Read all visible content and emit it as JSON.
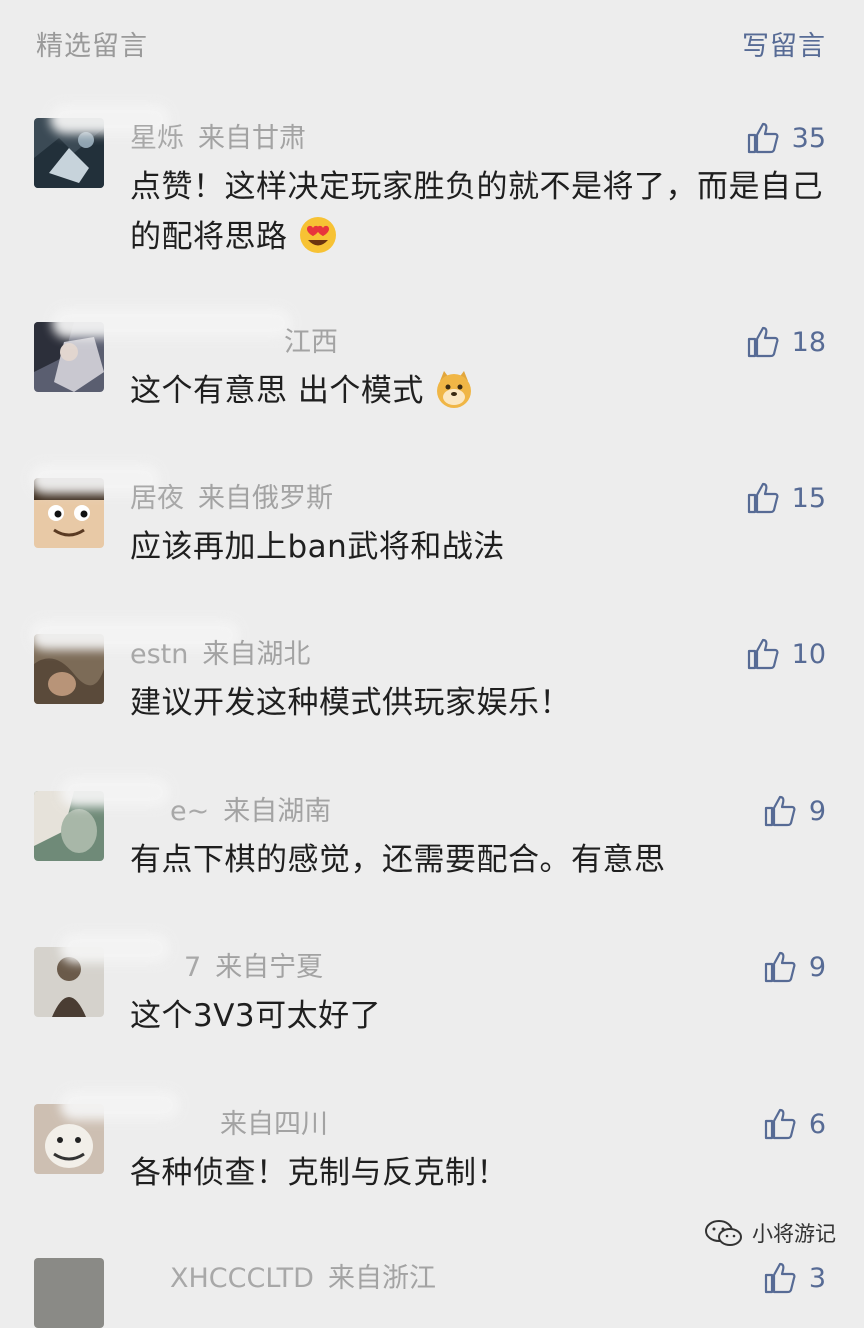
{
  "header": {
    "title": "精选留言",
    "write_link": "写留言"
  },
  "comments": [
    {
      "nickname": "星烁",
      "location": "来自甘肃",
      "text": "点赞！这样决定玩家胜负的就不是将了，而是自己的配将思路",
      "likes": "35"
    },
    {
      "nickname": "",
      "location": "江西",
      "text": "这个有意思  出个模式",
      "likes": "18"
    },
    {
      "nickname": "居夜",
      "location": "来自俄罗斯",
      "text": "应该再加上ban武将和战法",
      "likes": "15"
    },
    {
      "nickname": "estn",
      "location": "来自湖北",
      "text": "建议开发这种模式供玩家娱乐！",
      "likes": "10"
    },
    {
      "nickname": "e~",
      "location": "来自湖南",
      "text": "有点下棋的感觉，还需要配合。有意思",
      "likes": "9"
    },
    {
      "nickname": "7",
      "location": "来自宁夏",
      "text": "这个3V3可太好了",
      "likes": "9"
    },
    {
      "nickname": "",
      "location": "来自四川",
      "text": "各种侦查！克制与反克制！",
      "likes": "6"
    },
    {
      "nickname": "XHCCCLTD",
      "location": "来自浙江",
      "text": "",
      "likes": "3"
    }
  ],
  "watermark": {
    "text": "小将游记"
  },
  "colors": {
    "link": "#576b95",
    "background": "#ededed",
    "meta": "#a3a3a3",
    "text": "#1f1f1f"
  },
  "icons": {
    "like": "thumbs-up-icon",
    "watermark": "wechat-icon"
  }
}
